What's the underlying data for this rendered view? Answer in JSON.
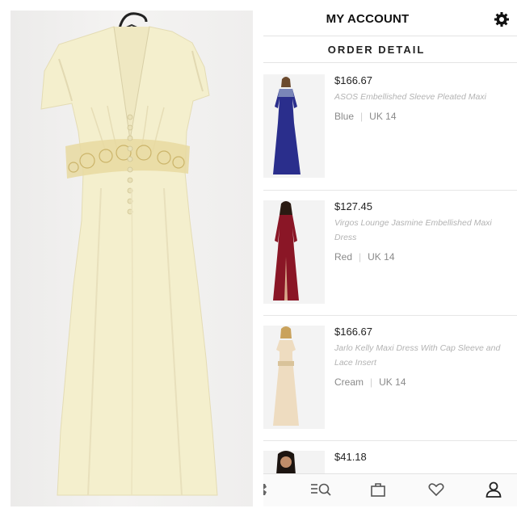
{
  "header": {
    "title": "MY ACCOUNT",
    "settings_icon": "gear-icon"
  },
  "subheader": {
    "title": "ORDER DETAIL"
  },
  "items": [
    {
      "price": "$166.67",
      "name": "ASOS Embellished Sleeve Pleated Maxi",
      "color": "Blue",
      "size": "UK 14",
      "swatch": "#2a2e8c"
    },
    {
      "price": "$127.45",
      "name": "Virgos Lounge Jasmine Embellished Maxi Dress",
      "color": "Red",
      "size": "UK 14",
      "swatch": "#8a1626"
    },
    {
      "price": "$166.67",
      "name": "Jarlo Kelly Maxi Dress With Cap Sleeve and Lace Insert",
      "color": "Cream",
      "size": "UK 14",
      "swatch": "#eedcc0"
    },
    {
      "price": "$41.18"
    }
  ],
  "tabbar": {
    "icons": [
      "home-icon",
      "search-icon",
      "bag-icon",
      "heart-icon",
      "account-icon"
    ]
  },
  "photo": {
    "dress_color": "#f4efcd"
  }
}
